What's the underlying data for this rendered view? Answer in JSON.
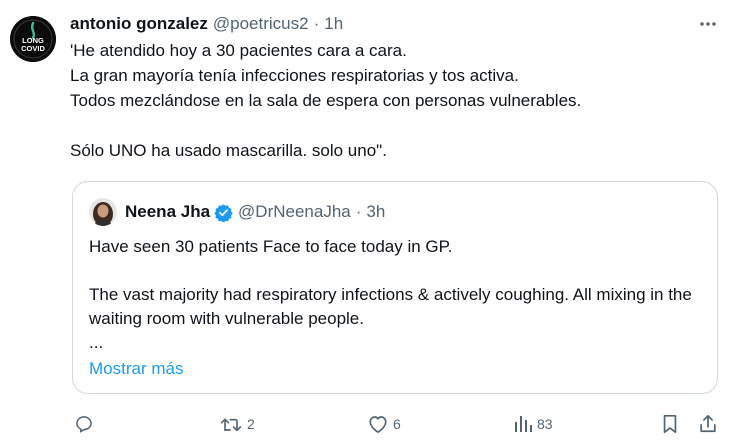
{
  "tweet": {
    "author_name": "antonio gonzalez",
    "author_handle": "@poetricus2",
    "separator": "·",
    "time": "1h",
    "avatar": {
      "icon": "long-covid-badge-icon",
      "label_line1": "LONG",
      "label_line2": "COVID"
    },
    "text": "'He atendido hoy a 30 pacientes cara a cara.\n La gran mayoría tenía infecciones respiratorias y tos activa.\nTodos mezclándose en la sala de espera con personas vulnerables.\n\nSólo UNO ha usado mascarilla. solo uno\"."
  },
  "quoted": {
    "author_name": "Neena Jha",
    "author_handle": "@DrNeenaJha",
    "separator": "·",
    "time": "3h",
    "text": "Have seen 30 patients Face to face today in GP.\n\nThe vast majority had respiratory infections & actively coughing. All mixing in the waiting room with vulnerable people.\n...",
    "show_more": "Mostrar más"
  },
  "actions": {
    "replies": "",
    "retweets": "2",
    "likes": "6",
    "views": "83"
  },
  "colors": {
    "text": "#0f1419",
    "secondary": "#536471",
    "link": "#1d9bf0",
    "border": "#cfd9de",
    "verified": "#1d9bf0"
  }
}
